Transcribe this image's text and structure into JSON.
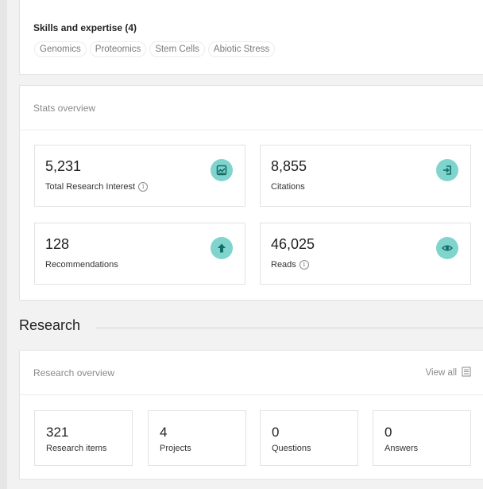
{
  "skills": {
    "title": "Skills and expertise (4)",
    "chips": [
      "Genomics",
      "Proteomics",
      "Stem Cells",
      "Abiotic Stress"
    ]
  },
  "stats": {
    "title": "Stats overview",
    "items": [
      {
        "value": "5,231",
        "label": "Total Research Interest",
        "info": "i",
        "icon": "research-interest-icon"
      },
      {
        "value": "8,855",
        "label": "Citations",
        "icon": "citations-icon"
      },
      {
        "value": "128",
        "label": "Recommendations",
        "icon": "recommendations-arrow-icon"
      },
      {
        "value": "46,025",
        "label": "Reads",
        "info": "i",
        "icon": "reads-eye-icon"
      }
    ],
    "accent_color": "#7fd5cd"
  },
  "research": {
    "section_title": "Research",
    "overview_title": "Research overview",
    "view_all_label": "View all",
    "counts": [
      {
        "value": "321",
        "label": "Research items"
      },
      {
        "value": "4",
        "label": "Projects"
      },
      {
        "value": "0",
        "label": "Questions"
      },
      {
        "value": "0",
        "label": "Answers"
      }
    ]
  }
}
